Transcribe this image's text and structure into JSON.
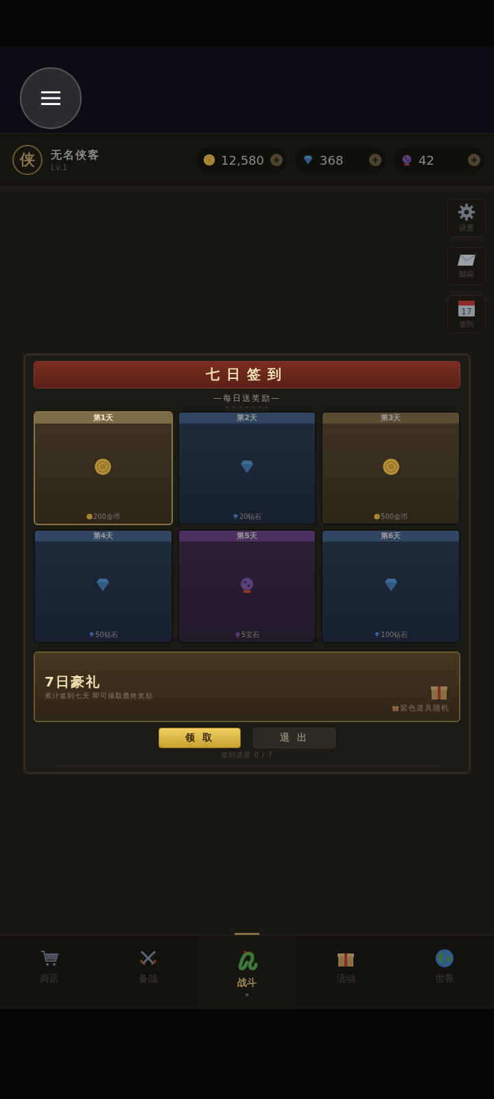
{
  "player": {
    "avatar": "侠",
    "name": "无名侠客",
    "level": "Lv.1"
  },
  "currencies": [
    {
      "kind": "coin",
      "value": "12,580"
    },
    {
      "kind": "diamond",
      "value": "368"
    },
    {
      "kind": "gem",
      "value": "42"
    }
  ],
  "side_buttons": [
    {
      "kind": "settings",
      "label": "设置"
    },
    {
      "kind": "mail",
      "label": "邮箱"
    },
    {
      "kind": "calendar",
      "label": "签到",
      "badge": "17"
    }
  ],
  "dialog": {
    "title": "七日签到",
    "subtitle": "—每日送奖励—",
    "days": [
      {
        "label": "第1天",
        "kind": "coin",
        "reward": "200金币",
        "selected": true
      },
      {
        "label": "第2天",
        "kind": "diamond",
        "reward": "20钻石",
        "selected": false
      },
      {
        "label": "第3天",
        "kind": "coin",
        "reward": "500金币",
        "selected": false
      },
      {
        "label": "第4天",
        "kind": "diamond",
        "reward": "50钻石",
        "selected": false
      },
      {
        "label": "第5天",
        "kind": "gem",
        "reward": "5宝石",
        "selected": false
      },
      {
        "label": "第6天",
        "kind": "diamond",
        "reward": "100钻石",
        "selected": false
      }
    ],
    "grand_prize": {
      "title": "7日豪礼",
      "description": "累计签到七天 即可领取最终奖励",
      "reward": "紫色道具随机"
    },
    "buttons": [
      {
        "kind": "primary",
        "label": "领 取"
      },
      {
        "kind": "secondary",
        "label": "退 出"
      }
    ],
    "progress": {
      "text": "签到进度 0 / 7",
      "level": 0
    }
  },
  "nav": [
    {
      "kind": "cart",
      "label": "商店",
      "selected": false
    },
    {
      "kind": "swords",
      "label": "备战",
      "selected": false
    },
    {
      "kind": "snake",
      "label": "战斗",
      "selected": true
    },
    {
      "kind": "gift",
      "label": "活动",
      "selected": false
    },
    {
      "kind": "globe",
      "label": "世界",
      "selected": false
    }
  ]
}
